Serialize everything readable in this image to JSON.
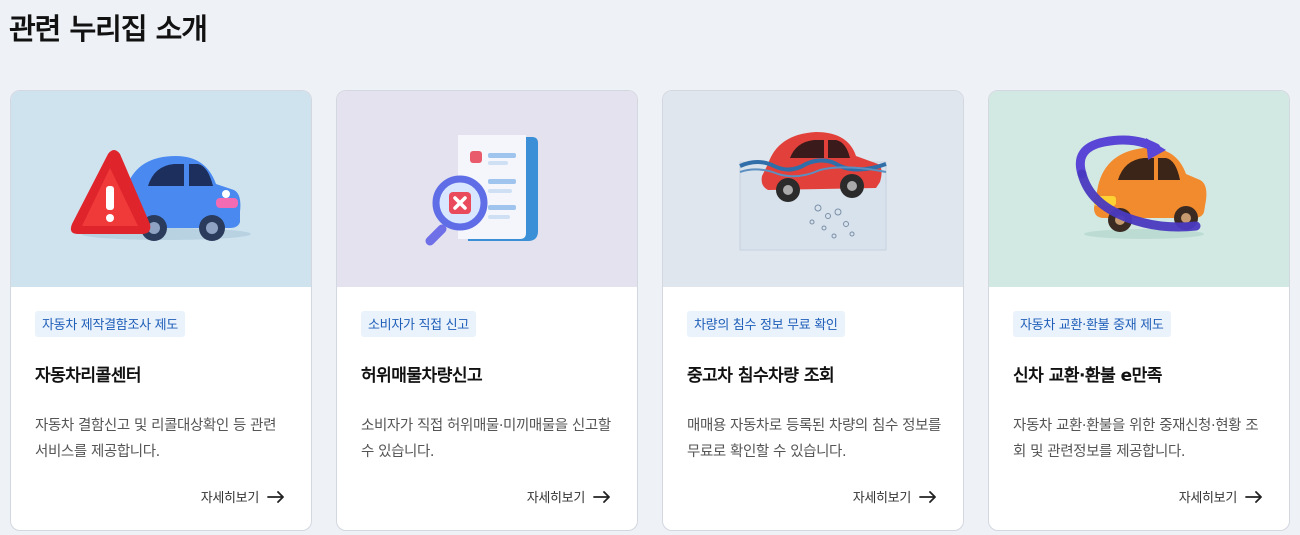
{
  "section": {
    "title": "관련 누리집 소개"
  },
  "cards": [
    {
      "visual_bg": "#cfe3ef",
      "illustration": "car-warning-icon",
      "tag": "자동차 제작결함조사 제도",
      "title": "자동차리콜센터",
      "description": "자동차 결함신고 및 리콜대상확인 등 관련 서비스를 제공합니다.",
      "link_label": "자세히보기",
      "link_icon": "arrow-right-icon"
    },
    {
      "visual_bg": "#e4e2ee",
      "illustration": "document-search-icon",
      "tag": "소비자가 직접 신고",
      "title": "허위매물차량신고",
      "description": "소비자가 직접 허위매물·미끼매물을 신고할 수 있습니다.",
      "link_label": "자세히보기",
      "link_icon": "arrow-right-icon"
    },
    {
      "visual_bg": "#dfe6ee",
      "illustration": "flooded-car-icon",
      "tag": "차량의 침수 정보 무료 확인",
      "title": "중고차 침수차량 조회",
      "description": "매매용 자동차로 등록된 차량의 침수 정보를 무료로 확인할 수 있습니다.",
      "link_label": "자세히보기",
      "link_icon": "arrow-right-icon"
    },
    {
      "visual_bg": "#d2e9e3",
      "illustration": "car-exchange-icon",
      "tag": "자동차 교환·환불 중재 제도",
      "title": "신차 교환·환불 e만족",
      "description": "자동차 교환·환불을 위한 중재신청·현황 조회 및 관련정보를 제공합니다.",
      "link_label": "자세히보기",
      "link_icon": "arrow-right-icon"
    }
  ]
}
